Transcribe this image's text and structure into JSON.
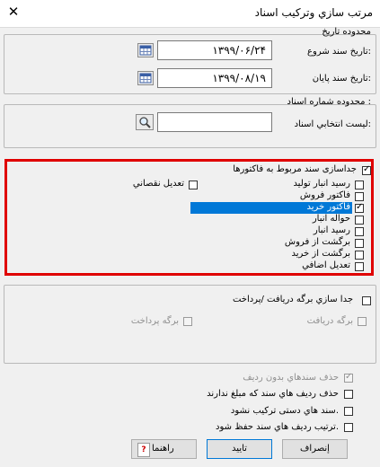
{
  "window": {
    "title": "مرتب سازي وترکيب اسناد"
  },
  "date_range": {
    "group_label": "محدوده تاريخ",
    "start_label": "تاريخ سند شروع:",
    "start_value": "۱۳۹۹/۰۶/۲۴",
    "end_label": "تاريخ سند پايان:",
    "end_value": "۱۳۹۹/۰۸/۱۹"
  },
  "doc_number_range": {
    "group_label": "محدوده شماره اسناد :",
    "list_label": "ليست انتخابي اسناد:",
    "list_value": ""
  },
  "invoice_separation": {
    "header_label": "جداسازی سند مربوط به فاکتورها",
    "header_checked": true,
    "items": [
      {
        "label": "رسيد انبار توليد",
        "checked": false
      },
      {
        "label": "فاکتور فروش",
        "checked": false
      },
      {
        "label": "فاکتور خريد",
        "checked": true,
        "selected": true
      },
      {
        "label": "حواله انبار",
        "checked": false
      },
      {
        "label": "رسيد انبار",
        "checked": false
      },
      {
        "label": "برگشت از فروش",
        "checked": false
      },
      {
        "label": "برگشت از خريد",
        "checked": false
      },
      {
        "label": "تعديل اضافي",
        "checked": false
      }
    ],
    "side_option": {
      "label": "تعديل نقصاني",
      "checked": false
    },
    "highlight_color": "#e00000",
    "selection_color": "#0078d7"
  },
  "receipt_payment": {
    "header_label": "جدا سازي برگه دريافت /پرداخت",
    "receipt_label": "برگه دريافت",
    "payment_label": "برگه پرداخت"
  },
  "options": {
    "delete_empty_docs": "حذف سندهاي بدون رديف",
    "delete_zero_rows": "حذف رديف هاي سند که مبلغ ندارند",
    "no_merge_manual": "سند هاي دستی ترکيب نشود.",
    "keep_row_order": "ترتيب رديف هاي سند حفظ شود."
  },
  "buttons": {
    "cancel": "إنصراف",
    "ok": "تاييد",
    "help": "راهنما"
  }
}
